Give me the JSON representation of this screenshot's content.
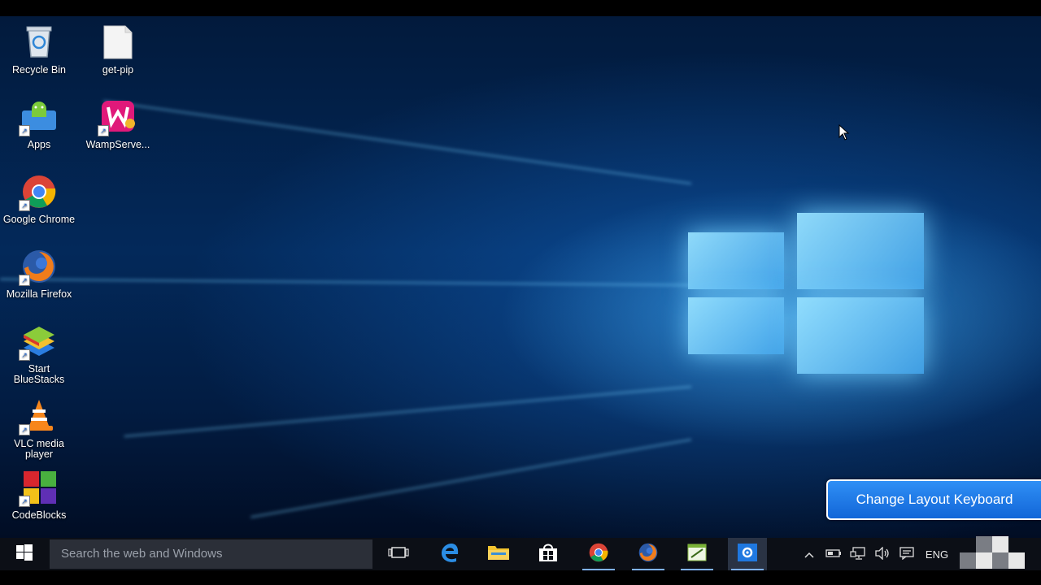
{
  "desktop_icons": [
    {
      "label": "Recycle Bin",
      "icon": "recycle-bin-icon"
    },
    {
      "label": "get-pip",
      "icon": "file-icon"
    },
    {
      "label": "Apps",
      "icon": "apps-icon"
    },
    {
      "label": "WampServe...",
      "icon": "wampserver-icon"
    },
    {
      "label": "Google Chrome",
      "icon": "chrome-icon"
    },
    {
      "label": "Mozilla Firefox",
      "icon": "firefox-icon"
    },
    {
      "label": "Start BlueStacks",
      "icon": "bluestacks-icon"
    },
    {
      "label": "VLC media player",
      "icon": "vlc-icon"
    },
    {
      "label": "CodeBlocks",
      "icon": "codeblocks-icon"
    }
  ],
  "notification": {
    "text": "Change Layout Keyboard"
  },
  "taskbar": {
    "search_placeholder": "Search the web and Windows",
    "apps": [
      "task-view-icon",
      "edge-icon",
      "file-explorer-icon",
      "store-icon",
      "chrome-icon",
      "firefox-icon",
      "notepad-icon",
      "settings-icon"
    ],
    "tray": {
      "language": "ENG"
    }
  },
  "colors": {
    "accent": "#1e78e6",
    "taskbar": "#0c0f16",
    "search_bg": "#2b2f38"
  }
}
